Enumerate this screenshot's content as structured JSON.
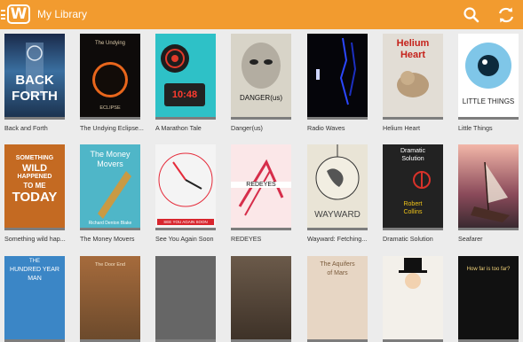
{
  "app": {
    "title": "My Library",
    "logo_glyph": "W",
    "accent_color": "#f29b2f",
    "icons": [
      "menu-icon",
      "wattpad-logo-icon",
      "search-icon",
      "refresh-icon"
    ]
  },
  "books": [
    {
      "title": "Back and Forth",
      "cover_text": [
        "BACK",
        "FORTH"
      ]
    },
    {
      "title": "The Undying Eclipse...",
      "cover_text": [
        "The Undying",
        "ECLIPSE"
      ]
    },
    {
      "title": "A Marathon Tale",
      "cover_text": [
        "10:48"
      ]
    },
    {
      "title": "Danger(us)",
      "cover_text": [
        "DANGER(us)"
      ]
    },
    {
      "title": "Radio Waves",
      "cover_text": []
    },
    {
      "title": "Helium Heart",
      "cover_text": [
        "Helium",
        "Heart"
      ]
    },
    {
      "title": "Little Things",
      "cover_text": [
        "LITTLE THINGS"
      ]
    },
    {
      "title": "Something wild hap...",
      "cover_text": [
        "SOMETHING",
        "WILD",
        "HAPPENED",
        "TO ME",
        "TODAY"
      ]
    },
    {
      "title": "The Money Movers",
      "cover_text": [
        "The Money",
        "Movers",
        "Richard Denton Blake"
      ]
    },
    {
      "title": "See You Again Soon",
      "cover_text": [
        "SEE YOU AGAIN SOON"
      ]
    },
    {
      "title": "REDEYES",
      "cover_text": [
        "REDEYES"
      ]
    },
    {
      "title": "Wayward: Fetching...",
      "cover_text": [
        "WAYWARD"
      ]
    },
    {
      "title": "Dramatic Solution",
      "cover_text": [
        "Dramatic",
        "Solution",
        "Robert",
        "Collins"
      ]
    },
    {
      "title": "Seafarer",
      "cover_text": []
    },
    {
      "title": "",
      "cover_text": [
        "THE",
        "HUNDRED YEAR",
        "MAN"
      ]
    },
    {
      "title": "",
      "cover_text": [
        "The Door End"
      ]
    },
    {
      "title": "",
      "cover_text": []
    },
    {
      "title": "",
      "cover_text": []
    },
    {
      "title": "",
      "cover_text": [
        "The Aquifers",
        "of Mars"
      ]
    },
    {
      "title": "",
      "cover_text": []
    },
    {
      "title": "",
      "cover_text": [
        "How far is too far?"
      ]
    }
  ]
}
